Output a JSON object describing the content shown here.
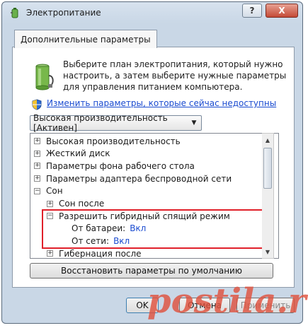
{
  "window": {
    "title": "Электропитание",
    "help_label": "?",
    "close_label": "X"
  },
  "tab": {
    "label": "Дополнительные параметры"
  },
  "description": "Выберите план электропитания, который нужно настроить, а затем выберите нужные параметры для управления питанием компьютера.",
  "change_link": "Изменить параметры, которые сейчас недоступны",
  "plan_select": {
    "value": "Высокая производительность [Активен]"
  },
  "tree": [
    {
      "label": "Высокая производительность",
      "expander": "+",
      "level": 0
    },
    {
      "label": "Жесткий диск",
      "expander": "+",
      "level": 0
    },
    {
      "label": "Параметры фона рабочего стола",
      "expander": "+",
      "level": 0
    },
    {
      "label": "Параметры адаптера беспроводной сети",
      "expander": "+",
      "level": 0
    },
    {
      "label": "Сон",
      "expander": "−",
      "level": 0
    },
    {
      "label": "Сон после",
      "expander": "+",
      "level": 1
    },
    {
      "label": "Разрешить гибридный спящий режим",
      "expander": "−",
      "level": 1
    },
    {
      "label": "От батареи:",
      "value": "Вкл",
      "level": 2
    },
    {
      "label": "От сети:",
      "value": "Вкл",
      "level": 2
    },
    {
      "label": "Гибернация после",
      "expander": "+",
      "level": 1
    }
  ],
  "restore_button": "Восстановить параметры по умолчанию",
  "buttons": {
    "ok": "OK",
    "cancel": "Отмена",
    "apply": "Применить"
  },
  "watermark": "postila.ru",
  "colors": {
    "link": "#1a4bd0",
    "highlight": "#e0202a",
    "watermark": "#e0533f"
  },
  "icons": {
    "app": "battery-plug-icon",
    "shield": "uac-shield-icon",
    "plan": "battery-icon"
  }
}
